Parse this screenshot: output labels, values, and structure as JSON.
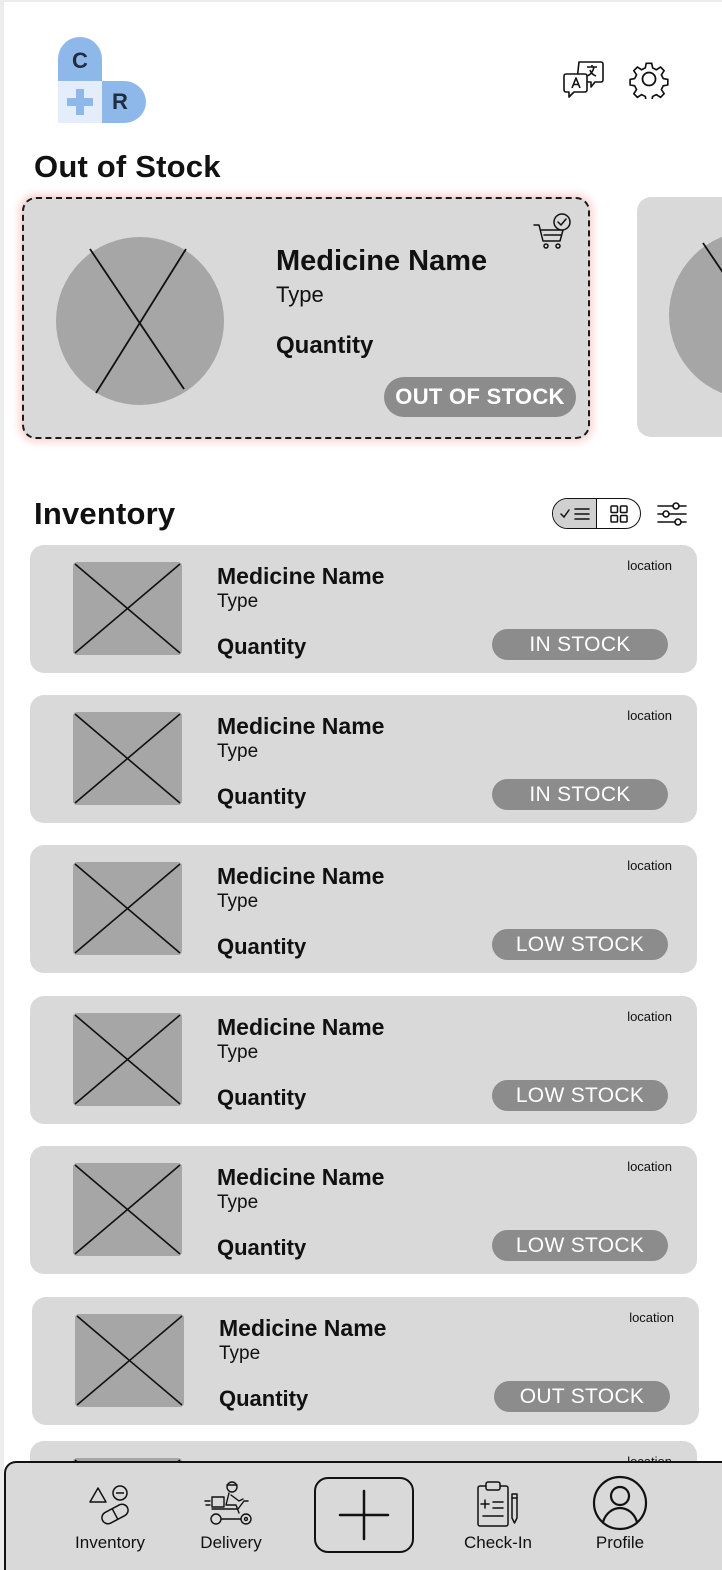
{
  "app": {
    "logo": {
      "letters": [
        "C",
        "R"
      ]
    }
  },
  "header": {
    "translate_icon": "translate-icon",
    "settings_icon": "gear-icon"
  },
  "out_of_stock": {
    "title": "Out of Stock",
    "cards": [
      {
        "name": "Medicine Name",
        "type": "Type",
        "quantity": "Quantity",
        "status": "OUT OF STOCK",
        "icon": "cart-check-icon"
      }
    ]
  },
  "inventory": {
    "title": "Inventory",
    "view_modes": [
      "list",
      "grid"
    ],
    "active_view": "list",
    "filter_icon": "sliders-icon",
    "items": [
      {
        "name": "Medicine Name",
        "type": "Type",
        "quantity": "Quantity",
        "location": "location",
        "status": "IN STOCK"
      },
      {
        "name": "Medicine Name",
        "type": "Type",
        "quantity": "Quantity",
        "location": "location",
        "status": "IN STOCK"
      },
      {
        "name": "Medicine Name",
        "type": "Type",
        "quantity": "Quantity",
        "location": "location",
        "status": "LOW STOCK"
      },
      {
        "name": "Medicine Name",
        "type": "Type",
        "quantity": "Quantity",
        "location": "location",
        "status": "LOW STOCK"
      },
      {
        "name": "Medicine Name",
        "type": "Type",
        "quantity": "Quantity",
        "location": "location",
        "status": "LOW STOCK"
      },
      {
        "name": "Medicine Name",
        "type": "Type",
        "quantity": "Quantity",
        "location": "location",
        "status": "OUT STOCK"
      },
      {
        "name": "",
        "type": "",
        "quantity": "",
        "location": "location",
        "status": ""
      }
    ]
  },
  "bottom_nav": {
    "items": [
      {
        "label": "Inventory",
        "icon": "pills-icon"
      },
      {
        "label": "Delivery",
        "icon": "delivery-scooter-icon"
      },
      {
        "label": "",
        "icon": "plus-icon"
      },
      {
        "label": "Check-In",
        "icon": "clipboard-icon"
      },
      {
        "label": "Profile",
        "icon": "user-icon"
      }
    ]
  },
  "colors": {
    "card_bg": "#d9d9d9",
    "badge_bg": "#8c8c8c",
    "logo_blue": "#8fb8ea",
    "logo_light": "#e4edfb",
    "oos_glow": "#ff5a5a"
  }
}
